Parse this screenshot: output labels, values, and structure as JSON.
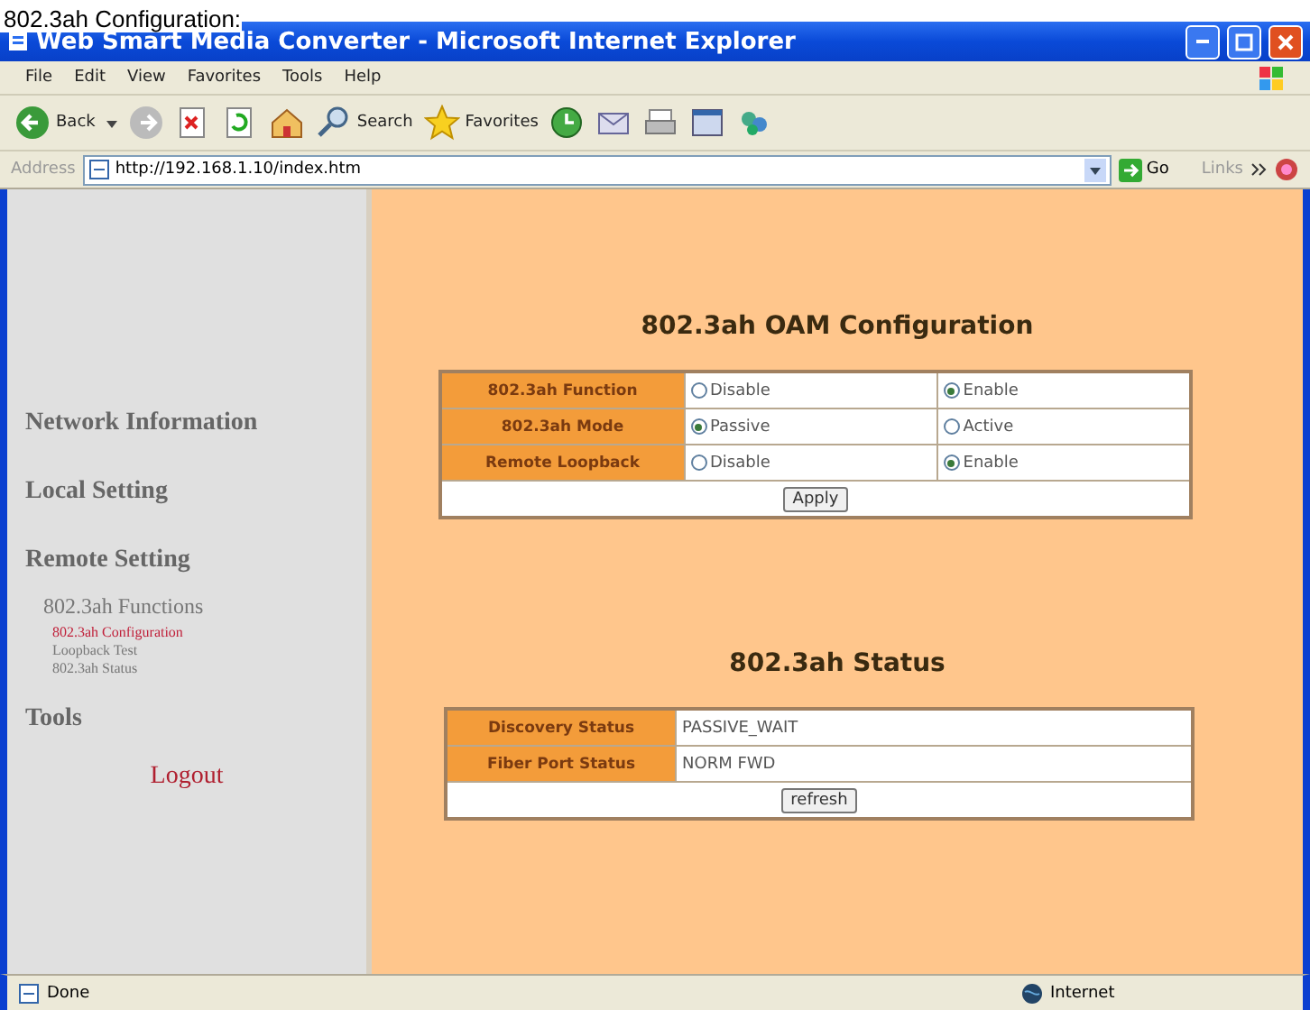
{
  "caption": "802.3ah Configuration:",
  "window": {
    "title": "Web Smart Media Converter - Microsoft Internet Explorer"
  },
  "menu": [
    "File",
    "Edit",
    "View",
    "Favorites",
    "Tools",
    "Help"
  ],
  "toolbar": {
    "back": "Back",
    "search": "Search",
    "favorites": "Favorites"
  },
  "address": {
    "label": "Address",
    "url": "http://192.168.1.10/index.htm",
    "go": "Go",
    "links": "Links"
  },
  "sidebar": {
    "items": [
      {
        "kind": "section",
        "label": "Network Information"
      },
      {
        "kind": "section",
        "label": "Local Setting"
      },
      {
        "kind": "section",
        "label": "Remote Setting",
        "children": [
          {
            "label": "802.3ah Functions",
            "children": [
              {
                "label": "802.3ah Configuration",
                "selected": true
              },
              {
                "label": "Loopback Test",
                "selected": false
              },
              {
                "label": "802.3ah Status",
                "selected": false
              }
            ]
          }
        ]
      },
      {
        "kind": "section",
        "label": "Tools"
      },
      {
        "kind": "logout",
        "label": "Logout"
      }
    ]
  },
  "config": {
    "title": "802.3ah OAM Configuration",
    "rows": [
      {
        "label": "802.3ah Function",
        "options": [
          {
            "label": "Disable",
            "selected": false
          },
          {
            "label": "Enable",
            "selected": true
          }
        ]
      },
      {
        "label": "802.3ah Mode",
        "options": [
          {
            "label": "Passive",
            "selected": true
          },
          {
            "label": "Active",
            "selected": false
          }
        ]
      },
      {
        "label": "Remote Loopback",
        "options": [
          {
            "label": "Disable",
            "selected": false
          },
          {
            "label": "Enable",
            "selected": true
          }
        ]
      }
    ],
    "button": "Apply"
  },
  "status": {
    "title": "802.3ah Status",
    "rows": [
      {
        "label": "Discovery Status",
        "value": "PASSIVE_WAIT"
      },
      {
        "label": "Fiber Port Status",
        "value": "NORM FWD"
      }
    ],
    "button": "refresh"
  },
  "status_bar": {
    "text": "Done",
    "zone": "Internet"
  }
}
